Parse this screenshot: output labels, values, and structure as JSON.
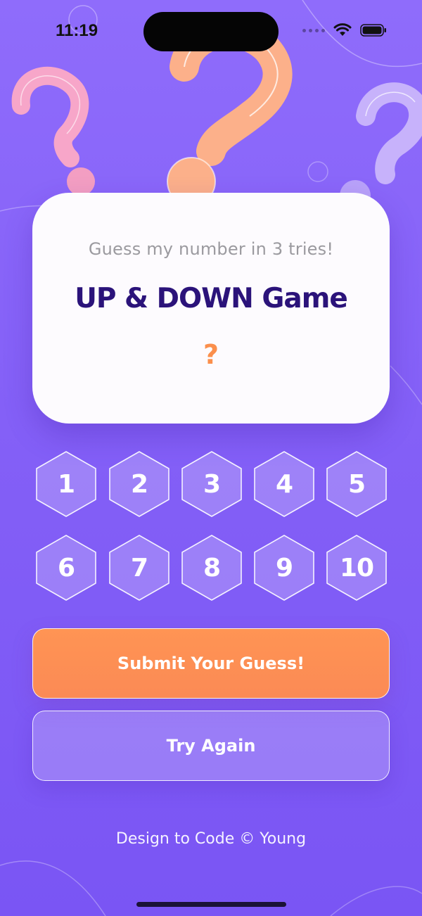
{
  "status_bar": {
    "time": "11:19"
  },
  "card": {
    "subtitle": "Guess my number in 3 tries!",
    "title": "UP & DOWN Game",
    "answer": "?"
  },
  "numbers": [
    "1",
    "2",
    "3",
    "4",
    "5",
    "6",
    "7",
    "8",
    "9",
    "10"
  ],
  "buttons": {
    "submit": "Submit Your Guess!",
    "retry": "Try Again"
  },
  "footer": "Design to Code © Young",
  "colors": {
    "background": "#8460f7",
    "title": "#2b137a",
    "accent": "#fb8f4c",
    "subtitle": "#9b9a9f"
  }
}
